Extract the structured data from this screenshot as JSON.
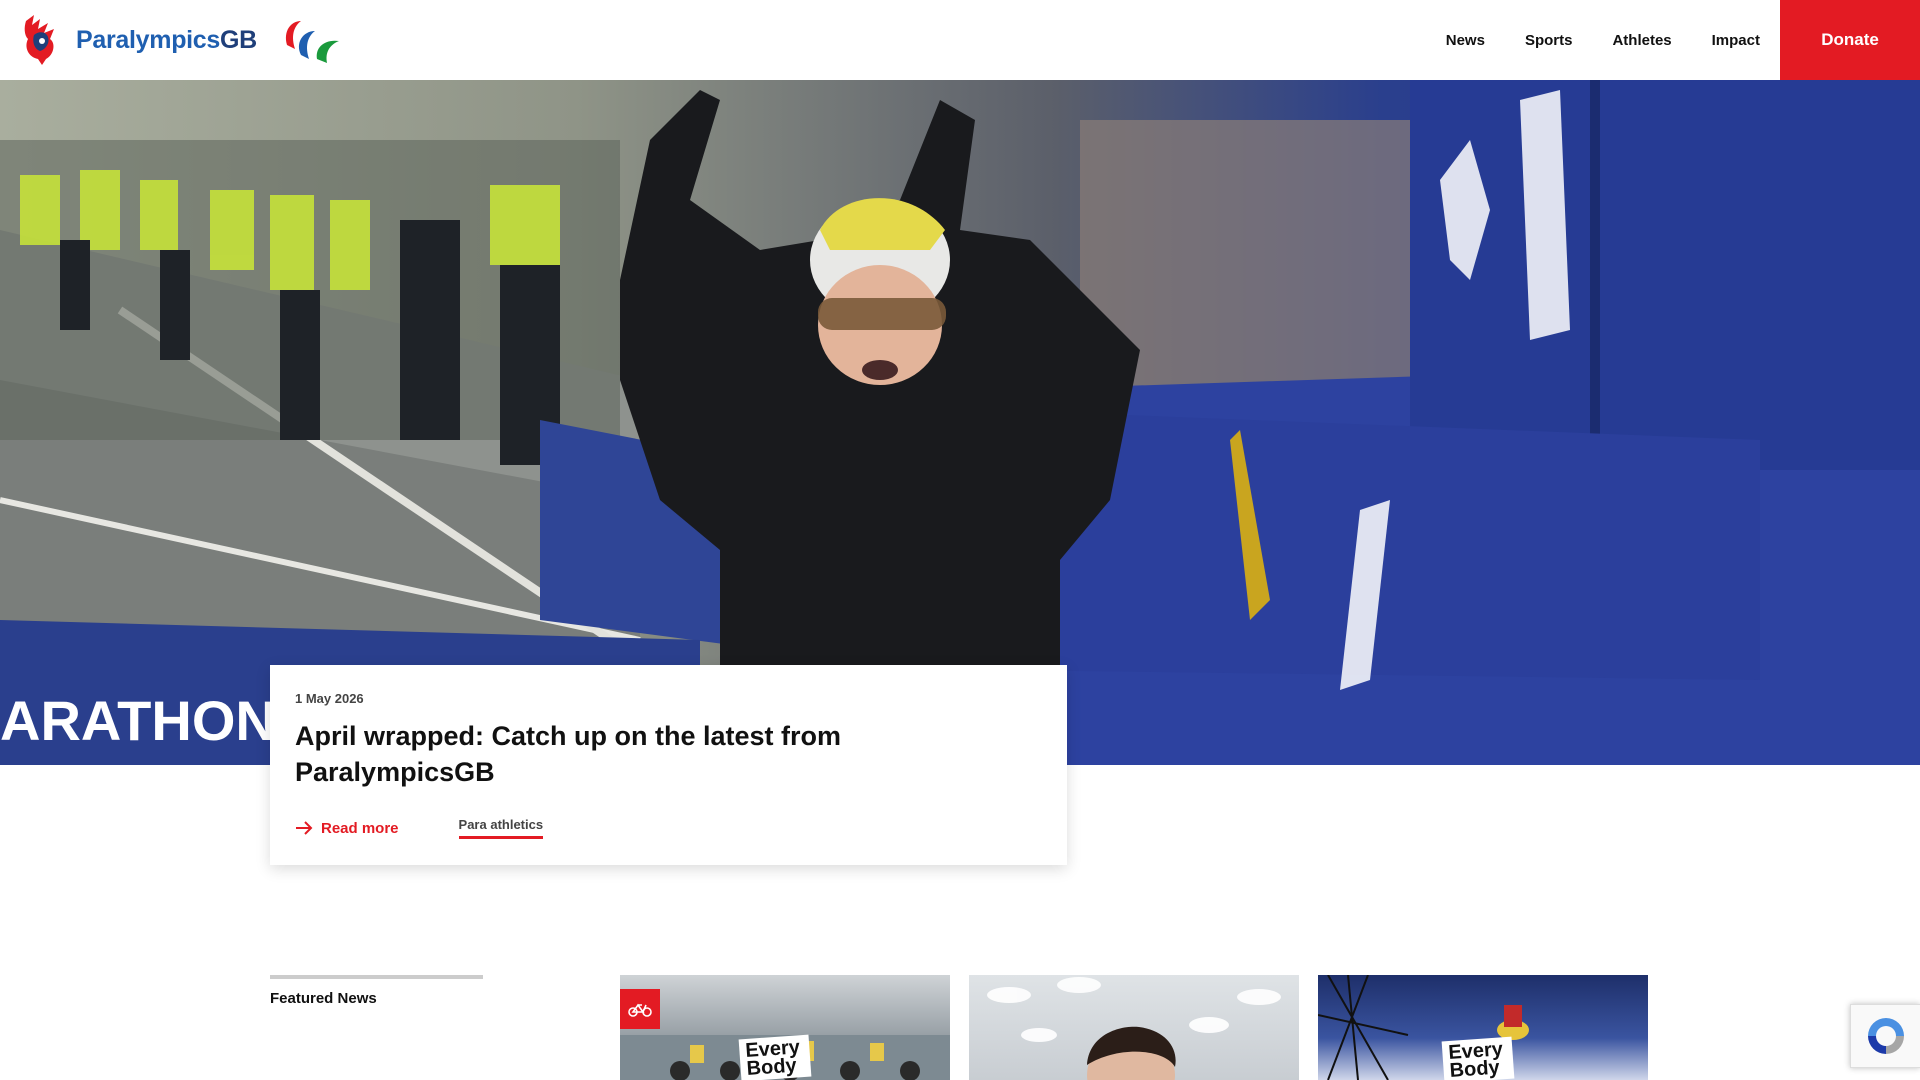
{
  "header": {
    "brand": {
      "name_prefix": "Paralympics",
      "name_suffix": "GB"
    },
    "nav": [
      {
        "label": "News"
      },
      {
        "label": "Sports"
      },
      {
        "label": "Athletes"
      },
      {
        "label": "Impact"
      }
    ],
    "donate_label": "Donate"
  },
  "hero_article": {
    "date": "1 May 2026",
    "title": "April wrapped: Catch up on the latest from ParalympicsGB",
    "read_more": "Read more",
    "tag": "Para athletics"
  },
  "hero_image": {
    "banner_text": "ARATHON"
  },
  "featured": {
    "label": "Featured News",
    "thumbnails": [
      {
        "overlay": "Every Body"
      },
      {
        "overlay": ""
      },
      {
        "overlay": "Every Body"
      }
    ]
  },
  "colors": {
    "accent_red": "#e31b23",
    "brand_blue": "#1f5fb0",
    "barrier_blue": "#2a3f8d"
  },
  "icons": {
    "read_more": "arrow-right-icon",
    "badge": "bicycle-icon",
    "captcha": "recaptcha-icon"
  }
}
